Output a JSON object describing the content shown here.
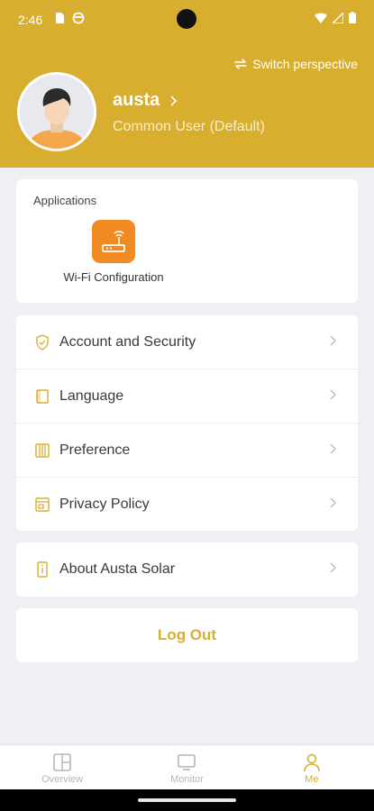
{
  "status_bar": {
    "time": "2:46"
  },
  "colors": {
    "brand": "#d8ae2e",
    "app_icon": "#f18a22",
    "background": "#eef0f4"
  },
  "header": {
    "switch_perspective": "Switch perspective",
    "user_name": "austa",
    "user_role": "Common User (Default)"
  },
  "applications": {
    "title": "Applications",
    "items": [
      {
        "label": "Wi-Fi Configuration",
        "icon": "wifi-router-icon"
      }
    ]
  },
  "menu": {
    "items": [
      {
        "label": "Account and Security",
        "icon": "shield-icon"
      },
      {
        "label": "Language",
        "icon": "book-icon"
      },
      {
        "label": "Preference",
        "icon": "sliders-icon"
      },
      {
        "label": "Privacy Policy",
        "icon": "window-icon"
      }
    ]
  },
  "about": {
    "label": "About Austa Solar",
    "icon": "info-icon"
  },
  "logout": {
    "label": "Log Out"
  },
  "tabbar": {
    "tabs": [
      {
        "label": "Overview",
        "icon": "grid-icon",
        "active": false
      },
      {
        "label": "Monitor",
        "icon": "monitor-icon",
        "active": false
      },
      {
        "label": "Me",
        "icon": "person-icon",
        "active": true
      }
    ]
  }
}
